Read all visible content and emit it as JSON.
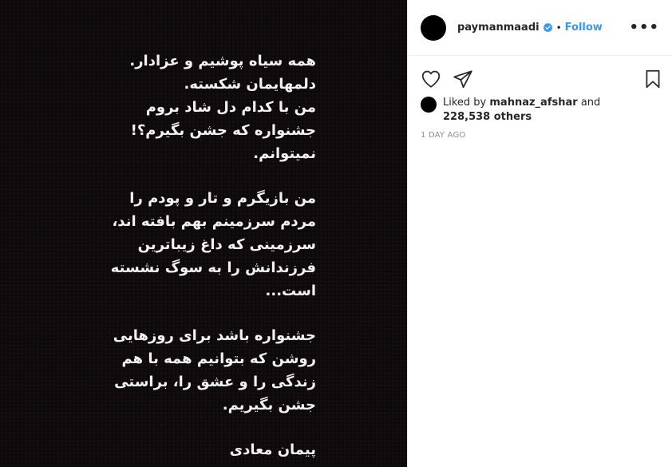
{
  "post": {
    "username": "paymanmaadi",
    "separator": "•",
    "follow_label": "Follow",
    "more_label": "•••",
    "liked_by_prefix": "Liked by",
    "liked_by_user": "mahnaz_afshar",
    "liked_by_and": "and",
    "likes_count": "228,538 others",
    "timestamp": "1 DAY AGO"
  },
  "colors": {
    "accent": "#3897f0",
    "media_background": "#0e0a0b"
  },
  "icons": {
    "verified": "verified-badge-icon",
    "like": "heart-icon",
    "share": "paper-plane-icon",
    "save": "bookmark-icon",
    "more": "more-options-icon"
  },
  "poem": {
    "stanzas": [
      {
        "lines": [
          "همه سیاه پوشیم و عزادار.",
          "دلمهایمان شکسته.",
          "من با کدام دل شاد بروم",
          "جشنواره که جشن بگیرم؟!",
          "نمیتوانم."
        ]
      },
      {
        "lines": [
          "من بازیگرم و تار و پودم را",
          "مردم  سرزمینم بهم بافته اند،",
          "سرزمینی که  داغ زیباترین",
          "فرزندانش را به سوگ نشسته",
          "است..."
        ]
      },
      {
        "lines": [
          "جشنواره باشد برای روزهایی",
          "روشن که بتوانیم همه با هم",
          "زندگی را و عشق را، براستی",
          "جشن بگیریم."
        ]
      },
      {
        "lines": [
          "پیمان معادی"
        ]
      }
    ]
  }
}
